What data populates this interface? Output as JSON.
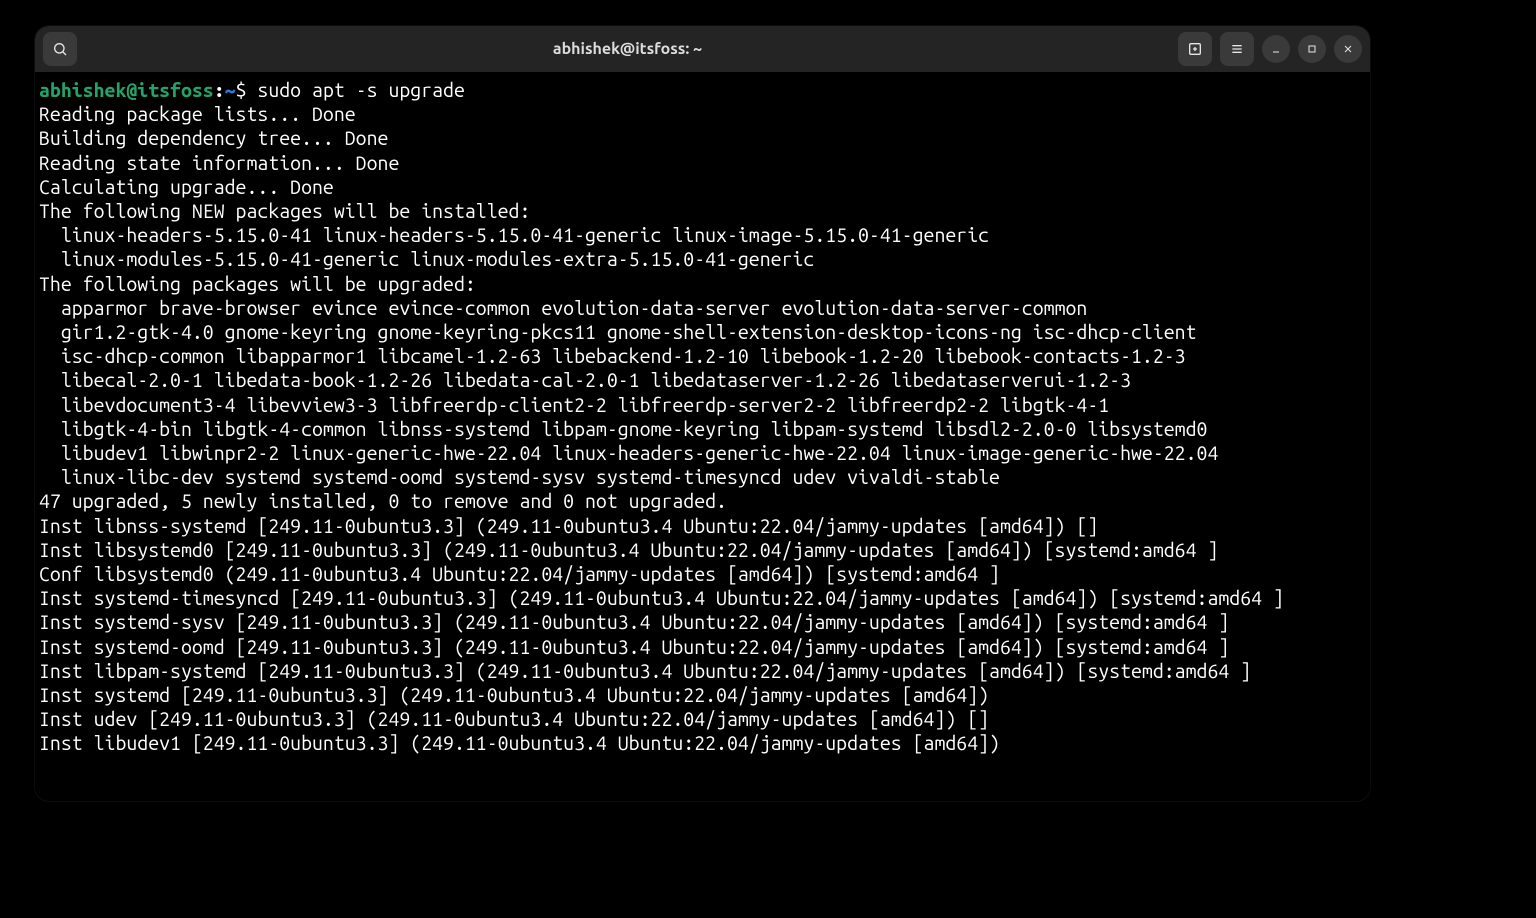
{
  "window": {
    "title": "abhishek@itsfoss: ~"
  },
  "prompt": {
    "user_host": "abhishek@itsfoss",
    "colon": ":",
    "path": "~",
    "dollar": "$",
    "command": "sudo apt -s upgrade"
  },
  "lines": {
    "l0": "Reading package lists... Done",
    "l1": "Building dependency tree... Done",
    "l2": "Reading state information... Done",
    "l3": "Calculating upgrade... Done",
    "l4": "The following NEW packages will be installed:",
    "l5": "  linux-headers-5.15.0-41 linux-headers-5.15.0-41-generic linux-image-5.15.0-41-generic",
    "l6": "  linux-modules-5.15.0-41-generic linux-modules-extra-5.15.0-41-generic",
    "l7": "The following packages will be upgraded:",
    "l8": "  apparmor brave-browser evince evince-common evolution-data-server evolution-data-server-common",
    "l9": "  gir1.2-gtk-4.0 gnome-keyring gnome-keyring-pkcs11 gnome-shell-extension-desktop-icons-ng isc-dhcp-client",
    "l10": "  isc-dhcp-common libapparmor1 libcamel-1.2-63 libebackend-1.2-10 libebook-1.2-20 libebook-contacts-1.2-3",
    "l11": "  libecal-2.0-1 libedata-book-1.2-26 libedata-cal-2.0-1 libedataserver-1.2-26 libedataserverui-1.2-3",
    "l12": "  libevdocument3-4 libevview3-3 libfreerdp-client2-2 libfreerdp-server2-2 libfreerdp2-2 libgtk-4-1",
    "l13": "  libgtk-4-bin libgtk-4-common libnss-systemd libpam-gnome-keyring libpam-systemd libsdl2-2.0-0 libsystemd0",
    "l14": "  libudev1 libwinpr2-2 linux-generic-hwe-22.04 linux-headers-generic-hwe-22.04 linux-image-generic-hwe-22.04",
    "l15": "  linux-libc-dev systemd systemd-oomd systemd-sysv systemd-timesyncd udev vivaldi-stable",
    "l16": "47 upgraded, 5 newly installed, 0 to remove and 0 not upgraded.",
    "l17": "Inst libnss-systemd [249.11-0ubuntu3.3] (249.11-0ubuntu3.4 Ubuntu:22.04/jammy-updates [amd64]) []",
    "l18": "Inst libsystemd0 [249.11-0ubuntu3.3] (249.11-0ubuntu3.4 Ubuntu:22.04/jammy-updates [amd64]) [systemd:amd64 ]",
    "l19": "Conf libsystemd0 (249.11-0ubuntu3.4 Ubuntu:22.04/jammy-updates [amd64]) [systemd:amd64 ]",
    "l20": "Inst systemd-timesyncd [249.11-0ubuntu3.3] (249.11-0ubuntu3.4 Ubuntu:22.04/jammy-updates [amd64]) [systemd:amd64 ]",
    "l21": "Inst systemd-sysv [249.11-0ubuntu3.3] (249.11-0ubuntu3.4 Ubuntu:22.04/jammy-updates [amd64]) [systemd:amd64 ]",
    "l22": "Inst systemd-oomd [249.11-0ubuntu3.3] (249.11-0ubuntu3.4 Ubuntu:22.04/jammy-updates [amd64]) [systemd:amd64 ]",
    "l23": "Inst libpam-systemd [249.11-0ubuntu3.3] (249.11-0ubuntu3.4 Ubuntu:22.04/jammy-updates [amd64]) [systemd:amd64 ]",
    "l24": "Inst systemd [249.11-0ubuntu3.3] (249.11-0ubuntu3.4 Ubuntu:22.04/jammy-updates [amd64])",
    "l25": "Inst udev [249.11-0ubuntu3.3] (249.11-0ubuntu3.4 Ubuntu:22.04/jammy-updates [amd64]) []",
    "l26": "Inst libudev1 [249.11-0ubuntu3.3] (249.11-0ubuntu3.4 Ubuntu:22.04/jammy-updates [amd64])"
  }
}
